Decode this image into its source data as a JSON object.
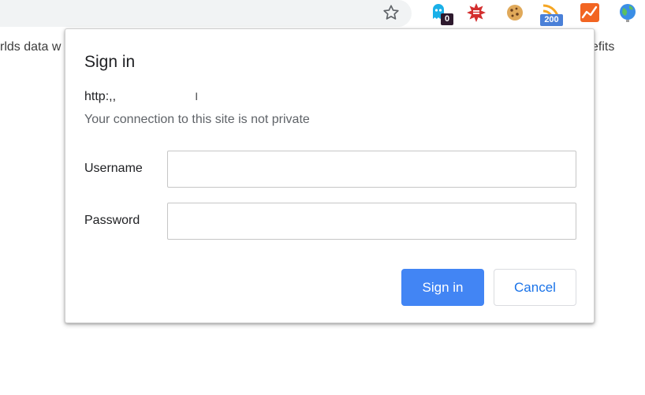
{
  "toolbar": {
    "bookmark_icon": "star-outline-icon",
    "extensions": [
      {
        "name": "ghostery-icon",
        "badge": "0",
        "badge_color": "#2e1a2e"
      },
      {
        "name": "starburst-extension-icon",
        "badge": ""
      },
      {
        "name": "cookie-icon",
        "badge": ""
      },
      {
        "name": "rss-feed-icon",
        "badge": "200",
        "badge_color": "#4a80d8"
      },
      {
        "name": "analytics-chart-icon",
        "badge": ""
      },
      {
        "name": "globe-icon",
        "badge": ""
      }
    ]
  },
  "page": {
    "left_fragment": "rlds data w",
    "right_fragment": "efits"
  },
  "dialog": {
    "title": "Sign in",
    "origin": "http:,,",
    "origin_tail": "ⅼ",
    "notice": "Your connection to this site is not private",
    "username_label": "Username",
    "username_value": "",
    "password_label": "Password",
    "password_value": "",
    "signin_label": "Sign in",
    "cancel_label": "Cancel"
  },
  "colors": {
    "primary_button": "#4285f4",
    "cancel_text": "#1a73e8",
    "ghostery": "#1ab0e8",
    "rss": "#f5a623",
    "analytics": "#f26522"
  }
}
